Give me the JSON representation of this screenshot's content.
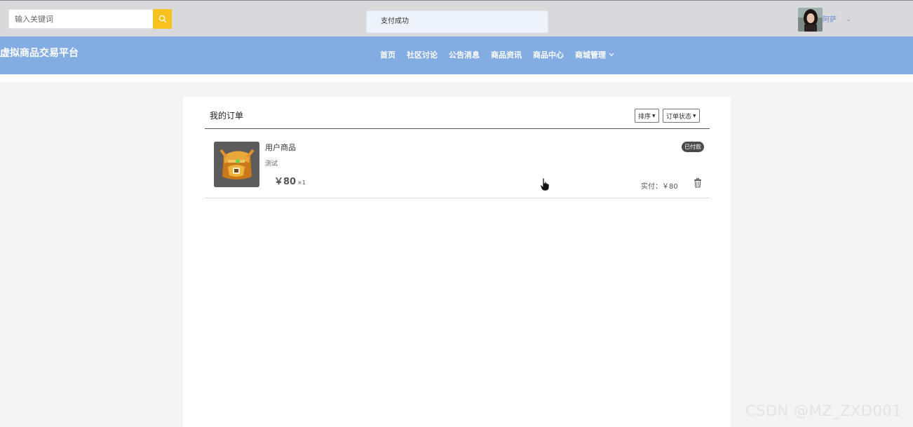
{
  "search": {
    "placeholder": "输入关键词"
  },
  "toast": {
    "message": "支付成功"
  },
  "user": {
    "name": "阿萨",
    "caret": "⌄"
  },
  "brand": {
    "title": "虚拟商品交易平台"
  },
  "nav": {
    "items": [
      {
        "label": "首页"
      },
      {
        "label": "社区讨论"
      },
      {
        "label": "公告消息"
      },
      {
        "label": "商品资讯"
      },
      {
        "label": "商品中心"
      },
      {
        "label": "商城管理"
      }
    ]
  },
  "orders": {
    "title": "我的订单",
    "sort_label": "排序",
    "status_label": "订单状态",
    "items": [
      {
        "name": "用户商品",
        "desc": "测试",
        "price": "￥80",
        "qty": "×1",
        "status": "已付款",
        "paid": "实付：￥80"
      }
    ]
  },
  "watermark": "CSDN @MZ_ZXD001",
  "colors": {
    "accent": "#f7c21e",
    "nav_bg": "#82ace2",
    "topbar_bg": "#d9d9db"
  }
}
